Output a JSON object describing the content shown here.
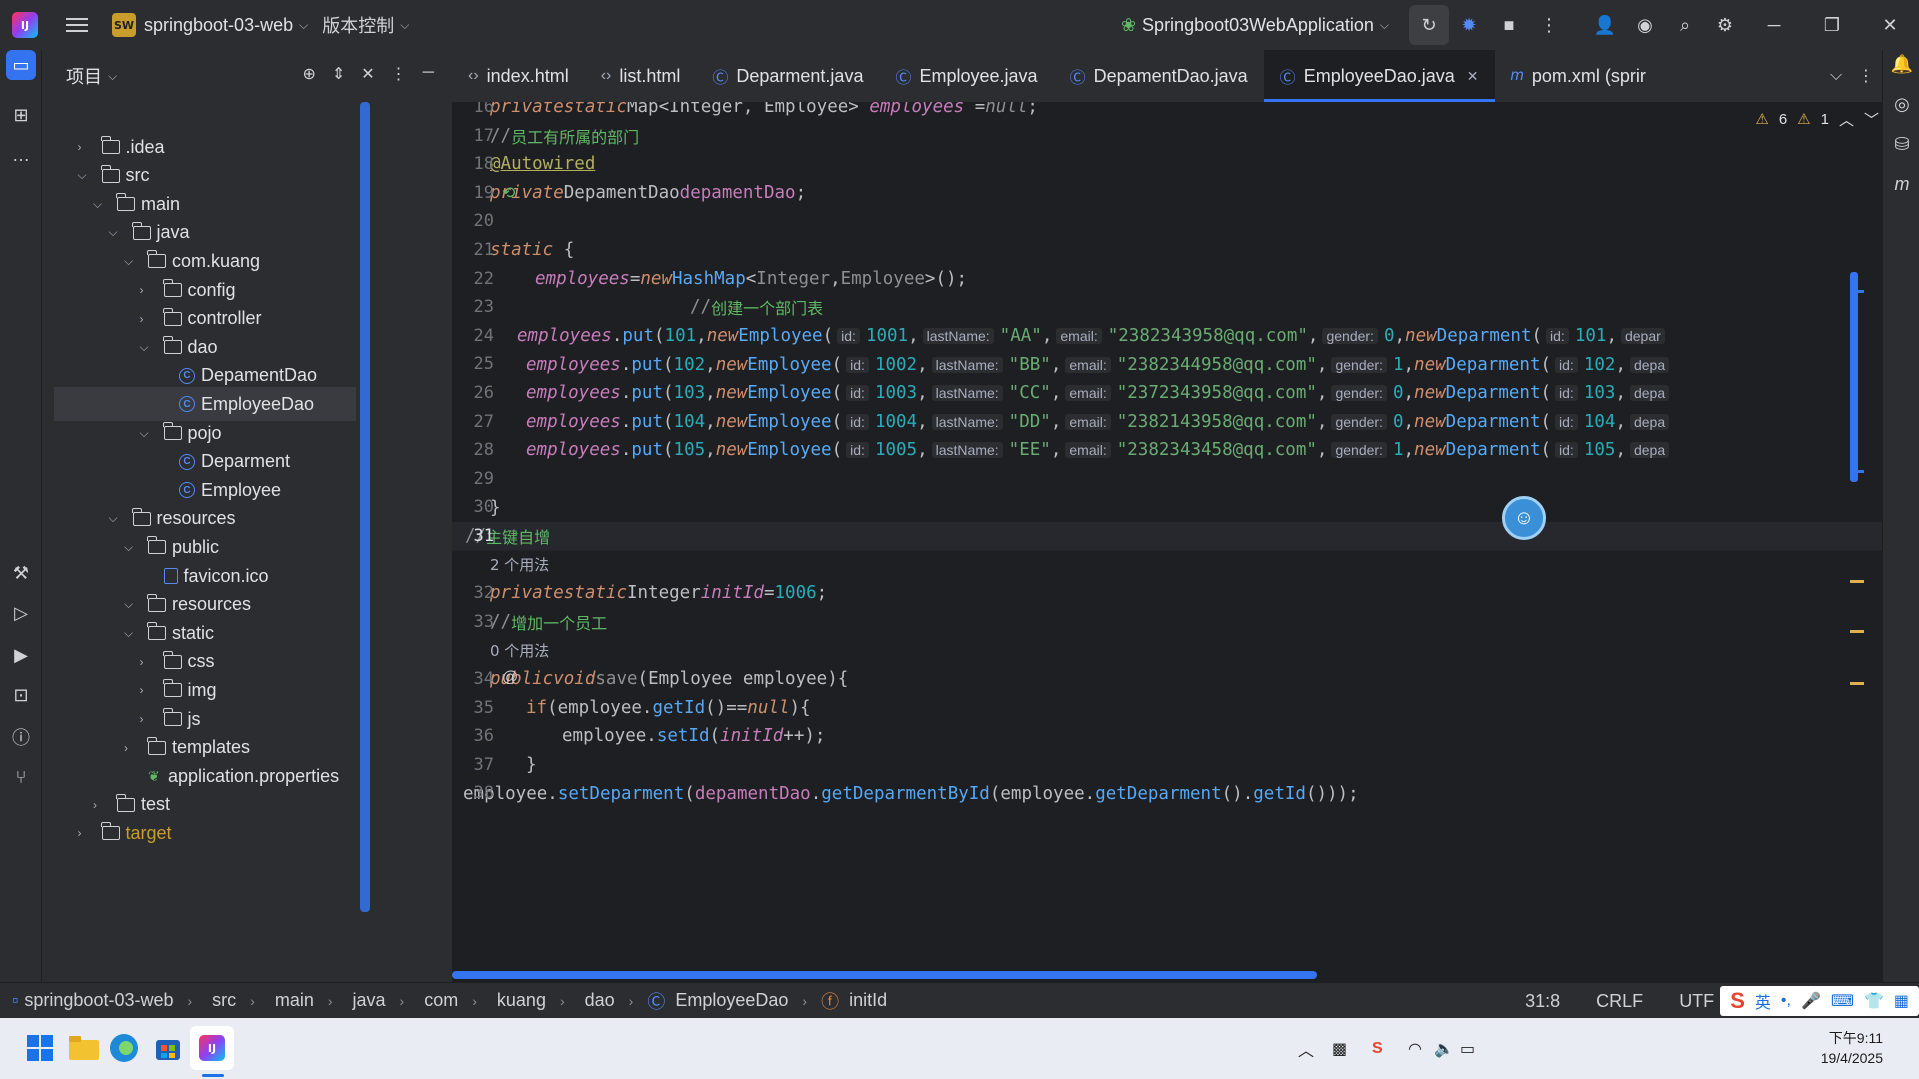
{
  "titlebar": {
    "project_badge": "SW",
    "project_name": "springboot-03-web",
    "vcs_label": "版本控制",
    "run_config": "Springboot03WebApplication"
  },
  "project_panel": {
    "title": "项目",
    "tree": [
      {
        "label": ".idea",
        "depth": 1,
        "type": "folder",
        "expanded": false
      },
      {
        "label": "src",
        "depth": 1,
        "type": "folder",
        "expanded": true
      },
      {
        "label": "main",
        "depth": 2,
        "type": "folder",
        "expanded": true
      },
      {
        "label": "java",
        "depth": 3,
        "type": "folder",
        "expanded": true
      },
      {
        "label": "com.kuang",
        "depth": 4,
        "type": "package",
        "expanded": true
      },
      {
        "label": "config",
        "depth": 5,
        "type": "package",
        "expanded": false
      },
      {
        "label": "controller",
        "depth": 5,
        "type": "package",
        "expanded": false
      },
      {
        "label": "dao",
        "depth": 5,
        "type": "package",
        "expanded": true
      },
      {
        "label": "DepamentDao",
        "depth": 6,
        "type": "class"
      },
      {
        "label": "EmployeeDao",
        "depth": 6,
        "type": "class",
        "selected": true
      },
      {
        "label": "pojo",
        "depth": 5,
        "type": "package",
        "expanded": true
      },
      {
        "label": "Deparment",
        "depth": 6,
        "type": "class"
      },
      {
        "label": "Employee",
        "depth": 6,
        "type": "class"
      },
      {
        "label": "resources",
        "depth": 3,
        "type": "folder",
        "expanded": true
      },
      {
        "label": "public",
        "depth": 4,
        "type": "folder",
        "expanded": true
      },
      {
        "label": "favicon.ico",
        "depth": 5,
        "type": "file"
      },
      {
        "label": "resources",
        "depth": 4,
        "type": "folder",
        "expanded": true
      },
      {
        "label": "static",
        "depth": 4,
        "type": "folder",
        "expanded": true
      },
      {
        "label": "css",
        "depth": 5,
        "type": "folder",
        "expanded": false
      },
      {
        "label": "img",
        "depth": 5,
        "type": "folder",
        "expanded": false
      },
      {
        "label": "js",
        "depth": 5,
        "type": "folder",
        "expanded": false
      },
      {
        "label": "templates",
        "depth": 4,
        "type": "folder",
        "expanded": false
      },
      {
        "label": "application.properties",
        "depth": 4,
        "type": "props"
      },
      {
        "label": "test",
        "depth": 2,
        "type": "folder",
        "expanded": false
      },
      {
        "label": "target",
        "depth": 1,
        "type": "folder",
        "expanded": false
      }
    ]
  },
  "tabs": [
    {
      "label": "index.html",
      "kind": "html"
    },
    {
      "label": "list.html",
      "kind": "html"
    },
    {
      "label": "Deparment.java",
      "kind": "class"
    },
    {
      "label": "Employee.java",
      "kind": "class"
    },
    {
      "label": "DepamentDao.java",
      "kind": "class"
    },
    {
      "label": "EmployeeDao.java",
      "kind": "class",
      "active": true
    },
    {
      "label": "pom.xml (sprir",
      "kind": "maven"
    }
  ],
  "editor": {
    "warnings": "6",
    "weak_warnings": "1",
    "current_line": "31",
    "lines": [
      {
        "n": "16",
        "html": "<span class='kw'>private</span>  <span class='kw'>static</span> <span class='typ'>Map</span><<span class='typ'>Integer</span>, <span class='typ'>Employee</span>> <span class='fld'>employees</span> =<span class='kw muted'>null</span>;",
        "indent": 38
      },
      {
        "n": "17",
        "html": "<span class='muted'>//</span><span class='cmt'>员工有所属的部门</span>",
        "indent": 38
      },
      {
        "n": "18",
        "html": "<span class='ann'>@Autowired</span>",
        "indent": 38
      },
      {
        "n": "19",
        "html": "<span class='kw'>private</span>  <span class='typ'>DepamentDao</span> <span class='fld-n'>depamentDao</span>;",
        "indent": 38
      },
      {
        "n": "20",
        "html": "",
        "indent": 38
      },
      {
        "n": "21",
        "html": "<span class='kw'>static</span> {",
        "indent": 38
      },
      {
        "n": "22",
        "html": "<span class='fld'>employees</span>=<span class='kw'>new</span> <span class='cls'>HashMap</span><<span class='muted'>Integer</span>,<span class='muted'>Employee</span>>();",
        "indent": 83
      },
      {
        "n": "23",
        "html": "<span class='muted'>//</span><span class='cmt'>创建一个部门表</span>",
        "indent": 238
      },
      {
        "n": "24",
        "html": "<span class='fld'>employees</span>.<span class='mth'>put</span>(<span class='num'>101</span>,<span class='kw'>new</span> <span class='cls'>Employee</span>(<span class='hint'>id:</span><span class='num'>1001</span>,<span class='hint'>lastName:</span><span class='str'>\"AA\"</span>,<span class='hint'>email:</span><span class='str'>\"2382343958@qq.com\"</span>,<span class='hint'>gender:</span><span class='num'>0</span>,<span class='kw'>new</span> <span class='cls'>Deparment</span>(<span class='hint'>id:</span><span class='num'>101</span>,<span class='hint'>depar</span>",
        "indent": 65
      },
      {
        "n": "25",
        "html": "<span class='fld'>employees</span>.<span class='mth'>put</span>(<span class='num'>102</span>,<span class='kw'>new</span> <span class='cls'>Employee</span>(<span class='hint'>id:</span><span class='num'>1002</span>,<span class='hint'>lastName:</span><span class='str'>\"BB\"</span>,<span class='hint'>email:</span><span class='str'>\"2382344958@qq.com\"</span>,<span class='hint'>gender:</span><span class='num'>1</span>,<span class='kw'>new</span> <span class='cls'>Deparment</span>(<span class='hint'>id:</span><span class='num'>102</span>,<span class='hint'>depa</span>",
        "indent": 74
      },
      {
        "n": "26",
        "html": "<span class='fld'>employees</span>.<span class='mth'>put</span>(<span class='num'>103</span>,<span class='kw'>new</span> <span class='cls'>Employee</span>(<span class='hint'>id:</span><span class='num'>1003</span>,<span class='hint'>lastName:</span><span class='str'>\"CC\"</span>,<span class='hint'>email:</span><span class='str'>\"2372343958@qq.com\"</span>,<span class='hint'>gender:</span><span class='num'>0</span>,<span class='kw'>new</span> <span class='cls'>Deparment</span>(<span class='hint'>id:</span><span class='num'>103</span>,<span class='hint'>depa</span>",
        "indent": 74
      },
      {
        "n": "27",
        "html": "<span class='fld'>employees</span>.<span class='mth'>put</span>(<span class='num'>104</span>,<span class='kw'>new</span> <span class='cls'>Employee</span>(<span class='hint'>id:</span><span class='num'>1004</span>,<span class='hint'>lastName:</span><span class='str'>\"DD\"</span>,<span class='hint'>email:</span><span class='str'>\"2382143958@qq.com\"</span>,<span class='hint'>gender:</span><span class='num'>0</span>,<span class='kw'>new</span> <span class='cls'>Deparment</span>(<span class='hint'>id:</span><span class='num'>104</span>,<span class='hint'>depa</span>",
        "indent": 74
      },
      {
        "n": "28",
        "html": "<span class='fld'>employees</span>.<span class='mth'>put</span>(<span class='num'>105</span>,<span class='kw'>new</span> <span class='cls'>Employee</span>(<span class='hint'>id:</span><span class='num'>1005</span>,<span class='hint'>lastName:</span><span class='str'>\"EE\"</span>,<span class='hint'>email:</span><span class='str'>\"2382343458@qq.com\"</span>,<span class='hint'>gender:</span><span class='num'>1</span>,<span class='kw'>new</span> <span class='cls'>Deparment</span>(<span class='hint'>id:</span><span class='num'>105</span>,<span class='hint'>depa</span>",
        "indent": 74
      },
      {
        "n": "29",
        "html": "",
        "indent": 38
      },
      {
        "n": "30",
        "html": "}",
        "indent": 38
      },
      {
        "n": "31",
        "html": "<span class='muted'>//</span><span class='cmt'>主键自增</span>",
        "indent": 13,
        "current": true
      },
      {
        "n": "",
        "html": "<span class='usage'>2 个用法</span>",
        "indent": 38
      },
      {
        "n": "32",
        "html": "<span class='kw'>private</span>  <span class='kw'>static</span>  <span class='typ'>Integer</span> <span class='fld'>initId</span>=<span class='num'>1006</span>;",
        "indent": 38
      },
      {
        "n": "33",
        "html": "<span class='muted'>//</span><span class='cmt'>增加一个员工</span>",
        "indent": 38
      },
      {
        "n": "",
        "html": "<span class='usage'>0 个用法</span>",
        "indent": 38
      },
      {
        "n": "34",
        "html": "<span class='kw'>public</span>  <span class='kw'>void</span> <span class='muted'>save</span>(<span class='typ'>Employee</span> employee){",
        "indent": 38
      },
      {
        "n": "35",
        "html": "<span class='kwn'>if</span>(employee.<span class='mth'>getId</span>()==<span class='kw'>null</span>){",
        "indent": 74
      },
      {
        "n": "36",
        "html": "employee.<span class='mth'>setId</span>(<span class='fld'>initId</span>++);",
        "indent": 110
      },
      {
        "n": "37",
        "html": "}",
        "indent": 74
      },
      {
        "n": "38",
        "html": "employee.<span class='mth'>setDeparment</span>(<span class='fld-n'>depamentDao</span>.<span class='mth'>getDeparmentById</span>(employee.<span class='mth'>getDeparment</span>().<span class='mth'>getId</span>()));",
        "indent": 11
      }
    ]
  },
  "breadcrumb": [
    "springboot-03-web",
    "src",
    "main",
    "java",
    "com",
    "kuang",
    "dao",
    "EmployeeDao",
    "initId"
  ],
  "status": {
    "position": "31:8",
    "line_ending": "CRLF",
    "encoding": "UTF",
    "ime_lang": "英"
  },
  "taskbar": {
    "time": "下午9:11",
    "date": "19/4/2025"
  }
}
